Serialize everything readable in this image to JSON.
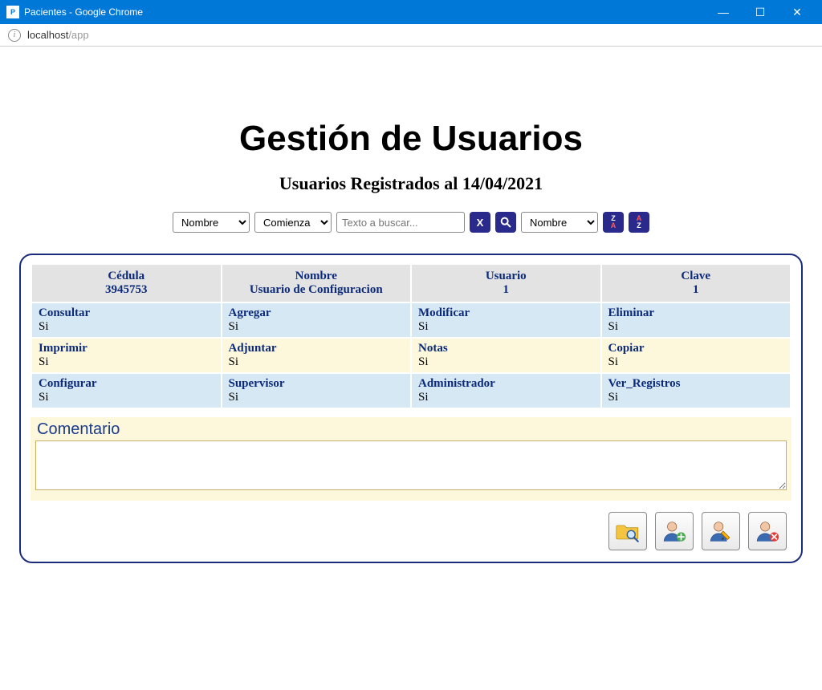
{
  "window": {
    "title": "Pacientes - Google Chrome",
    "url_host": "localhost",
    "url_path": "/app"
  },
  "page": {
    "title": "Gestión de Usuarios",
    "subtitle": "Usuarios Registrados al 14/04/2021"
  },
  "filters": {
    "field_select": "Nombre",
    "match_select": "Comienza",
    "search_placeholder": "Texto a buscar...",
    "sort_field_select": "Nombre",
    "clear_symbol": "X",
    "search_symbol": "🔍",
    "sort_desc_label": "Z↓A",
    "sort_asc_label": "A↓Z"
  },
  "user_header": {
    "cedula": {
      "label": "Cédula",
      "value": "3945753"
    },
    "nombre": {
      "label": "Nombre",
      "value": "Usuario de Configuracion"
    },
    "usuario": {
      "label": "Usuario",
      "value": "1"
    },
    "clave": {
      "label": "Clave",
      "value": "1"
    }
  },
  "permissions": [
    {
      "style": "blue",
      "cells": [
        {
          "label": "Consultar",
          "value": "Si"
        },
        {
          "label": "Agregar",
          "value": "Si"
        },
        {
          "label": "Modificar",
          "value": "Si"
        },
        {
          "label": "Eliminar",
          "value": "Si"
        }
      ]
    },
    {
      "style": "yellow",
      "cells": [
        {
          "label": "Imprimir",
          "value": "Si"
        },
        {
          "label": "Adjuntar",
          "value": "Si"
        },
        {
          "label": "Notas",
          "value": "Si"
        },
        {
          "label": "Copiar",
          "value": "Si"
        }
      ]
    },
    {
      "style": "blue",
      "cells": [
        {
          "label": "Configurar",
          "value": "Si"
        },
        {
          "label": "Supervisor",
          "value": "Si"
        },
        {
          "label": "Administrador",
          "value": "Si"
        },
        {
          "label": "Ver_Registros",
          "value": "Si"
        }
      ]
    }
  ],
  "comentario": {
    "label": "Comentario",
    "value": ""
  },
  "actions": {
    "view": "Ver",
    "add": "Agregar",
    "edit": "Editar",
    "delete": "Eliminar"
  }
}
